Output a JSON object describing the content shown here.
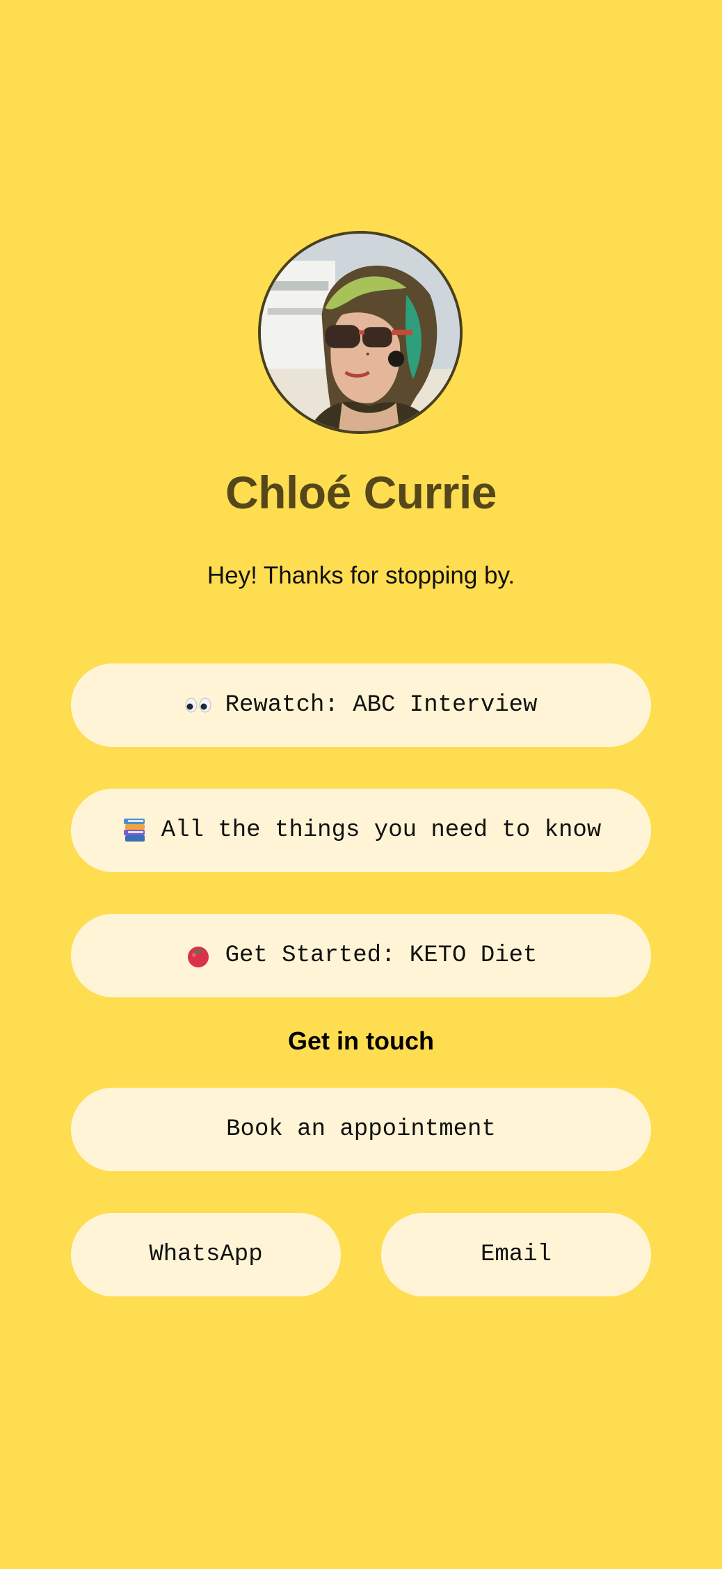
{
  "profile": {
    "name": "Chloé Currie",
    "bio": "Hey! Thanks for stopping by.",
    "avatar_alt": "profile-photo"
  },
  "links": [
    {
      "icon": "eyes-emoji",
      "label": "Rewatch: ABC Interview"
    },
    {
      "icon": "books-emoji",
      "label": "All the things you need to know"
    },
    {
      "icon": "tomato-emoji",
      "label": "Get Started: KETO Diet"
    }
  ],
  "contact": {
    "title": "Get in touch",
    "book_label": "Book an appointment",
    "whatsapp_label": "WhatsApp",
    "email_label": "Email"
  },
  "colors": {
    "background": "#FFDD50",
    "button": "#FFF5D6",
    "name": "#55471A"
  }
}
